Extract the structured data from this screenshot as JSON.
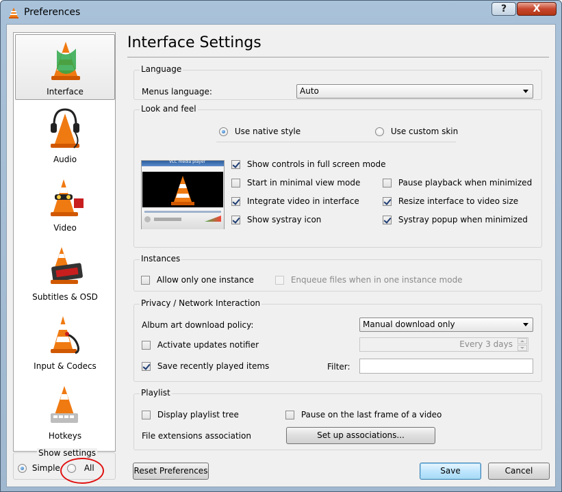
{
  "window": {
    "title": "Preferences",
    "help_label": "?",
    "close_label": "X"
  },
  "sidebar": {
    "items": [
      {
        "label": "Interface",
        "selected": true
      },
      {
        "label": "Audio",
        "selected": false
      },
      {
        "label": "Video",
        "selected": false
      },
      {
        "label": "Subtitles & OSD",
        "selected": false
      },
      {
        "label": "Input & Codecs",
        "selected": false
      },
      {
        "label": "Hotkeys",
        "selected": false
      }
    ]
  },
  "show_settings": {
    "label": "Show settings",
    "simple_label": "Simple",
    "all_label": "All",
    "selected": "Simple"
  },
  "main": {
    "title": "Interface Settings",
    "language": {
      "group_title": "Language",
      "menus_label": "Menus language:",
      "menus_value": "Auto"
    },
    "look": {
      "group_title": "Look and feel",
      "native_label": "Use native style",
      "custom_label": "Use custom skin",
      "fullscreen_controls": "Show controls in full screen mode",
      "minimal_view": "Start in minimal view mode",
      "pause_minimized": "Pause playback when minimized",
      "integrate_video": "Integrate video in interface",
      "resize_interface": "Resize interface to video size",
      "systray_icon": "Show systray icon",
      "systray_popup": "Systray popup when minimized",
      "preview_title": "VLC media player"
    },
    "instances": {
      "group_title": "Instances",
      "one_instance": "Allow only one instance",
      "enqueue": "Enqueue files when in one instance mode"
    },
    "privacy": {
      "group_title": "Privacy / Network Interaction",
      "album_label": "Album art download policy:",
      "album_value": "Manual download only",
      "updates_label": "Activate updates notifier",
      "updates_interval": "Every 3 days",
      "recent_label": "Save recently played items",
      "filter_label": "Filter:",
      "filter_value": ""
    },
    "playlist": {
      "group_title": "Playlist",
      "tree_label": "Display playlist tree",
      "pause_last": "Pause on the last frame of a video",
      "ext_label": "File extensions association",
      "setup_button": "Set up associations..."
    }
  },
  "footer": {
    "reset_label": "Reset Preferences",
    "save_label": "Save",
    "cancel_label": "Cancel"
  },
  "colors": {
    "cone_orange": "#f07a12",
    "annotation_red": "#e01010"
  }
}
